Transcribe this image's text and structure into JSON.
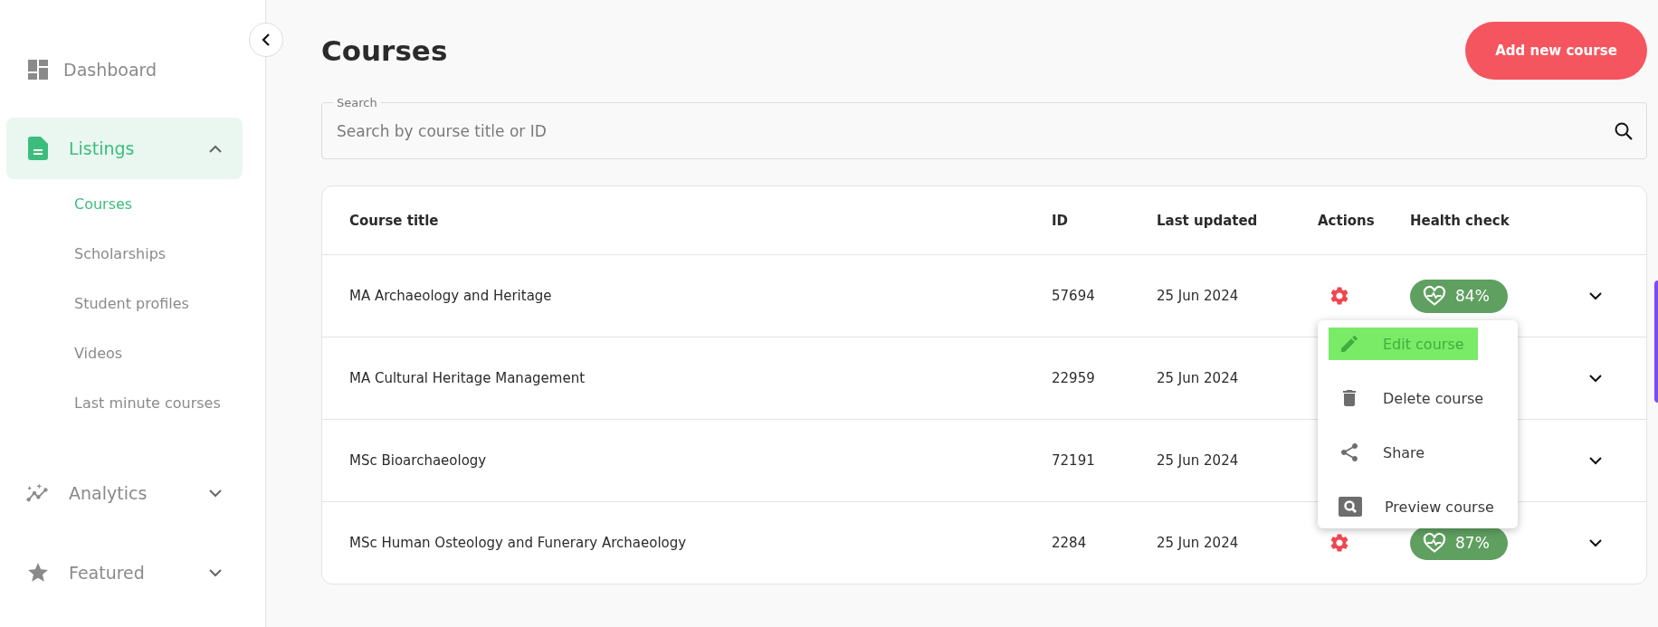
{
  "sidebar": {
    "items": [
      {
        "label": "Dashboard",
        "kind": "dashboard",
        "selected": false
      },
      {
        "label": "Listings",
        "kind": "listings",
        "selected": true,
        "expanded": true,
        "children": [
          {
            "label": "Courses",
            "selected": true
          },
          {
            "label": "Scholarships",
            "selected": false
          },
          {
            "label": "Student profiles",
            "selected": false
          },
          {
            "label": "Videos",
            "selected": false
          },
          {
            "label": "Last minute courses",
            "selected": false
          }
        ]
      },
      {
        "label": "Analytics",
        "kind": "analytics",
        "selected": false,
        "expanded": false
      },
      {
        "label": "Featured",
        "kind": "featured",
        "selected": false,
        "expanded": false
      }
    ]
  },
  "page": {
    "title": "Courses",
    "add_button": "Add new course"
  },
  "search": {
    "label": "Search",
    "placeholder": "Search by course title or ID"
  },
  "table": {
    "columns": [
      "Course title",
      "ID",
      "Last updated",
      "Actions",
      "Health check"
    ],
    "rows": [
      {
        "title": "MA Archaeology and Heritage",
        "id": "57694",
        "updated": "25 Jun 2024",
        "health": "84%"
      },
      {
        "title": "MA Cultural Heritage Management",
        "id": "22959",
        "updated": "25 Jun 2024"
      },
      {
        "title": "MSc Bioarchaeology",
        "id": "72191",
        "updated": "25 Jun 2024"
      },
      {
        "title": "MSc Human Osteology and Funerary Archaeology",
        "id": "2284",
        "updated": "25 Jun 2024",
        "health": "87%"
      }
    ]
  },
  "action_menu": {
    "items": [
      {
        "label": "Edit course",
        "kind": "edit",
        "selected": true
      },
      {
        "label": "Delete course",
        "kind": "delete",
        "selected": false
      },
      {
        "label": "Share",
        "kind": "share",
        "selected": false
      },
      {
        "label": "Preview course",
        "kind": "preview",
        "selected": false
      }
    ]
  }
}
